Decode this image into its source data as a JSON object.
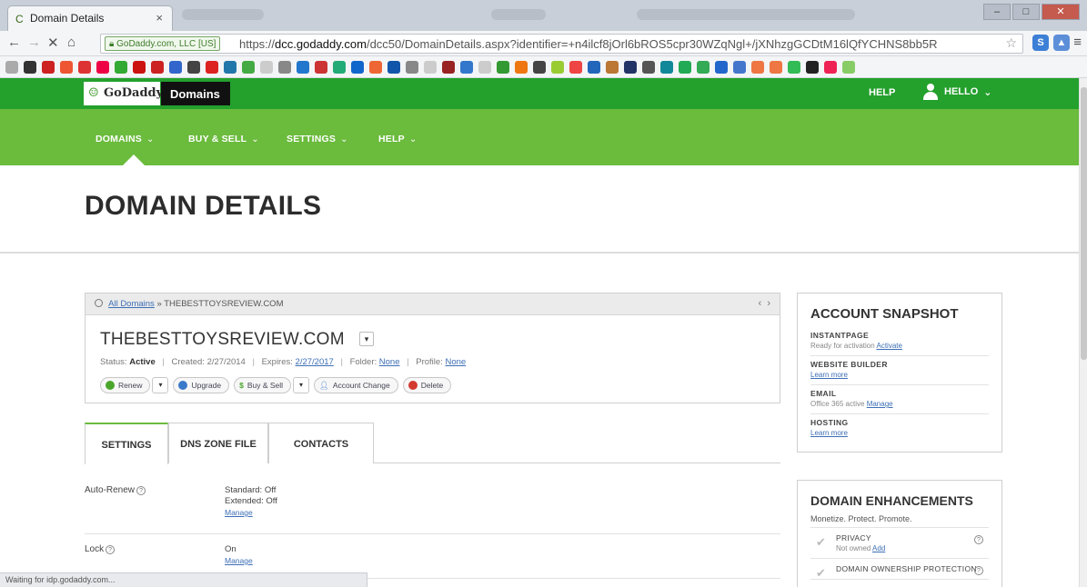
{
  "browser": {
    "tab_title": "Domain Details",
    "tab_close": "×",
    "secure_badge": "GoDaddy.com, LLC [US]",
    "url_scheme": "https://",
    "url_host": "dcc.godaddy.com",
    "url_path": "/dcc50/DomainDetails.aspx?identifier=+n4ilcf8jOrl6bROS5cpr30WZqNgl+/jXNhzgGCDtM16lQfYCHNS8bb5R",
    "status_text": "Waiting for idp.godaddy.com..."
  },
  "header": {
    "logo_text": "GoDaddy",
    "section_label": "Domains",
    "help_label": "HELP",
    "user_label": "HELLO",
    "nav": [
      {
        "label": "DOMAINS"
      },
      {
        "label": "BUY & SELL"
      },
      {
        "label": "SETTINGS"
      },
      {
        "label": "HELP"
      }
    ]
  },
  "page": {
    "title": "DOMAIN DETAILS"
  },
  "domain": {
    "breadcrumb_link": "All Domains",
    "breadcrumb_sep": "»",
    "breadcrumb_current": "THEBESTTOYSREVIEW.COM",
    "name": "THEBESTTOYSREVIEW.COM",
    "status_label": "Status:",
    "status_value": "Active",
    "created_label": "Created:",
    "created_value": "2/27/2014",
    "expires_label": "Expires:",
    "expires_value": "2/27/2017",
    "folder_label": "Folder:",
    "folder_value": "None",
    "profile_label": "Profile:",
    "profile_value": "None",
    "actions": {
      "renew": "Renew",
      "upgrade": "Upgrade",
      "buy_sell": "Buy & Sell",
      "account_change": "Account Change",
      "delete": "Delete"
    }
  },
  "tabs": [
    {
      "label": "SETTINGS"
    },
    {
      "label": "DNS ZONE FILE"
    },
    {
      "label": "CONTACTS"
    }
  ],
  "settings": {
    "auto_renew": {
      "label": "Auto-Renew",
      "standard": "Standard: Off",
      "extended": "Extended: Off",
      "link": "Manage"
    },
    "lock": {
      "label": "Lock",
      "value": "On",
      "link": "Manage"
    }
  },
  "snapshot": {
    "title": "ACCOUNT SNAPSHOT",
    "items": [
      {
        "head": "INSTANTPAGE",
        "desc": "Ready for activation",
        "link": "Activate"
      },
      {
        "head": "WEBSITE BUILDER",
        "desc": "",
        "link": "Learn more"
      },
      {
        "head": "EMAIL",
        "desc": "Office 365 active",
        "link": "Manage"
      },
      {
        "head": "HOSTING",
        "desc": "",
        "link": "Learn more"
      }
    ]
  },
  "enhancements": {
    "title": "DOMAIN ENHANCEMENTS",
    "subtitle": "Monetize. Protect. Promote.",
    "items": [
      {
        "name": "PRIVACY",
        "desc": "Not owned",
        "link": "Add"
      },
      {
        "name": "DOMAIN OWNERSHIP PROTECTION",
        "desc": "",
        "link": ""
      }
    ]
  },
  "colors": {
    "brand_green_dark": "#24a02d",
    "brand_green_light": "#6bbb3d",
    "link_blue": "#3d6fb5"
  }
}
